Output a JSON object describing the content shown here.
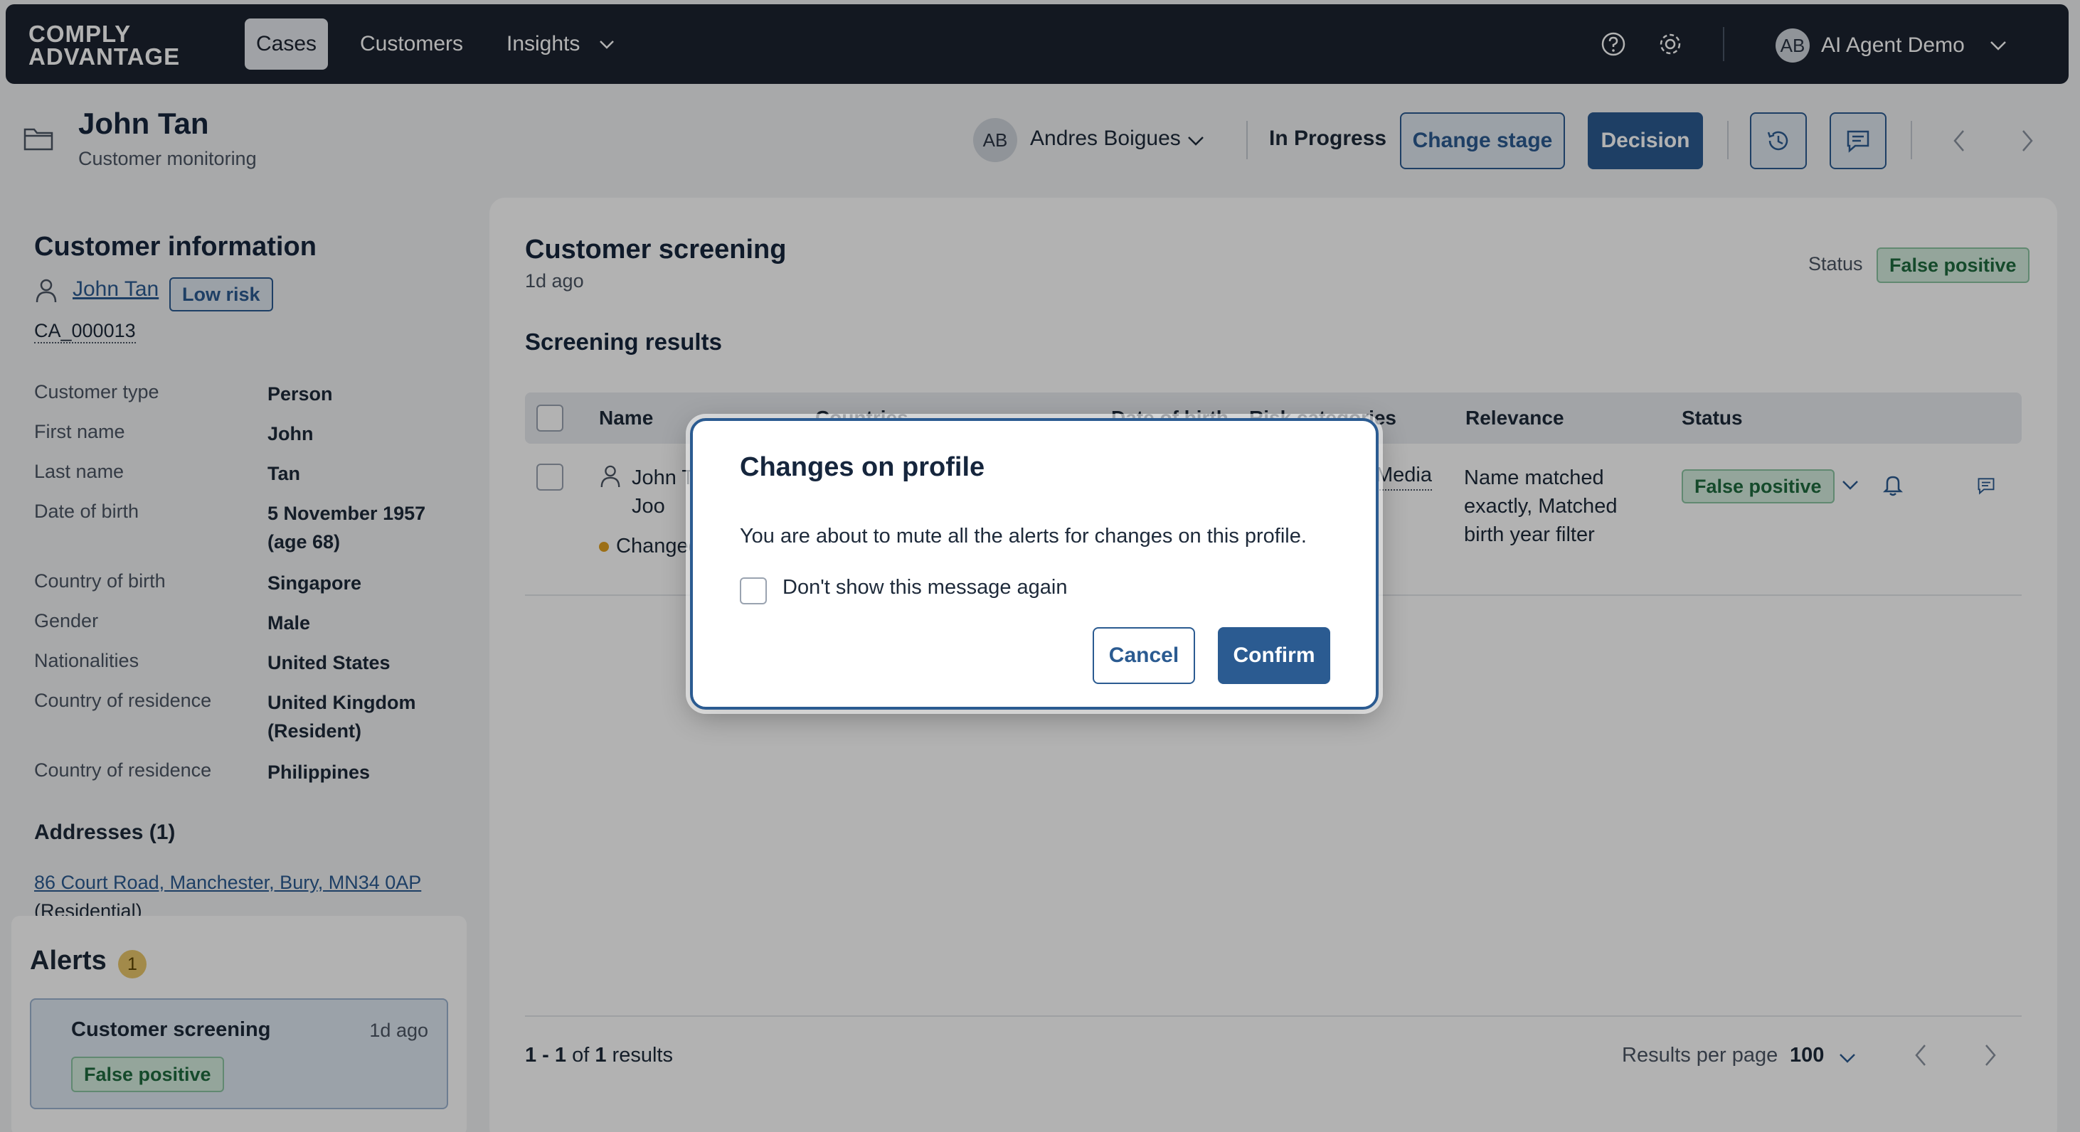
{
  "app": {
    "logo_line1": "COMPLY",
    "logo_line2": "ADVANTAGE"
  },
  "nav": {
    "cases": "Cases",
    "customers": "Customers",
    "insights": "Insights"
  },
  "user": {
    "initials": "AB",
    "name": "AI Agent Demo"
  },
  "case": {
    "title": "John Tan",
    "subtitle": "Customer monitoring",
    "assignee_initials": "AB",
    "assignee_name": "Andres Boigues",
    "state": "In Progress",
    "change_stage_label": "Change stage",
    "decision_label": "Decision"
  },
  "customer_info": {
    "heading": "Customer information",
    "name": "John Tan",
    "risk": "Low risk",
    "id": "CA_000013",
    "fields": [
      {
        "label": "Customer type",
        "value": "Person"
      },
      {
        "label": "First name",
        "value": "John"
      },
      {
        "label": "Last name",
        "value": "Tan"
      },
      {
        "label": "Date of birth",
        "value": "5 November 1957",
        "value2": "(age 68)"
      },
      {
        "label": "Country of birth",
        "value": "Singapore"
      },
      {
        "label": "Gender",
        "value": "Male"
      },
      {
        "label": "Nationalities",
        "value": "United States"
      },
      {
        "label": "Country of residence",
        "value": "United Kingdom",
        "value2": "(Resident)"
      },
      {
        "label": "Country of residence",
        "value": "Philippines"
      }
    ],
    "addresses_heading": "Addresses (1)",
    "address": "86 Court Road, Manchester, Bury, MN34 0AP",
    "address_type": "(Residential)"
  },
  "alerts": {
    "heading": "Alerts",
    "count": "1",
    "card_title": "Customer screening",
    "card_time": "1d ago",
    "card_status": "False positive"
  },
  "screening": {
    "title": "Customer screening",
    "time": "1d ago",
    "status_label": "Status",
    "status_value": "False positive",
    "results_heading": "Screening results",
    "columns": {
      "name": "Name",
      "countries": "Countries",
      "dob": "Date of birth",
      "risk": "Risk categories",
      "relevance": "Relevance",
      "status": "Status"
    },
    "row": {
      "name_line1": "John T",
      "name_line2": "Joo",
      "change_tag": "Changed",
      "risk": "Media",
      "relevance": [
        "Name matched",
        "exactly, Matched",
        "birth year filter"
      ],
      "status": "False positive"
    },
    "pagination": {
      "range": "1 - 1",
      "of_text": "of",
      "total": "1",
      "results_text": "results",
      "per_page_label": "Results per page",
      "per_page_value": "100"
    }
  },
  "modal": {
    "title": "Changes on profile",
    "message": "You are about to mute all the alerts for changes on this profile.",
    "checkbox_label": "Don't show this message again",
    "cancel_label": "Cancel",
    "confirm_label": "Confirm"
  }
}
